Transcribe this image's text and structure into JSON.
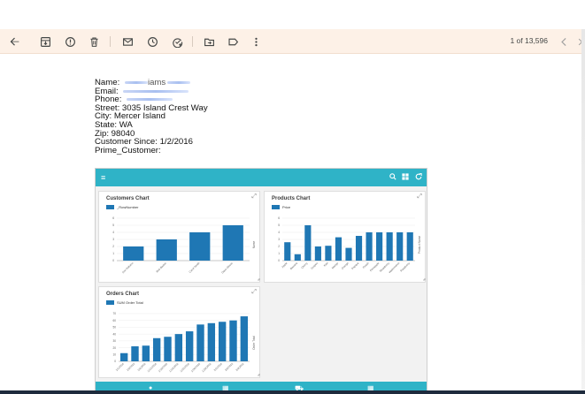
{
  "toolbar": {
    "pager_text": "1 of 13,596"
  },
  "customer": {
    "name_label": "Name:",
    "name_value_visible": "iams",
    "email_label": "Email:",
    "phone_label": "Phone:",
    "street": "Street: 3035 Island Crest Way",
    "city": "City: Mercer Island",
    "state": "State: WA",
    "zip": "Zip: 98040",
    "since": "Customer Since: 1/2/2016",
    "prime": "Prime_Customer:"
  },
  "dashboard": {
    "accent": "#2fb3c7",
    "bar_color": "#1f77b4"
  },
  "chart_data": [
    {
      "type": "bar",
      "title": "Customers Chart",
      "legend": "_RowNumber",
      "categories": [
        "Ann Nakano",
        "Bob Barker",
        "Carol Smith",
        "Dave Glover"
      ],
      "values": [
        2,
        3,
        4,
        5
      ],
      "ylim": [
        0,
        6
      ],
      "yticks": [
        "0",
        "1",
        "2",
        "3",
        "4",
        "5",
        "6"
      ],
      "ylabel": "Name"
    },
    {
      "type": "bar",
      "title": "Products Chart",
      "legend": "Price",
      "categories": [
        "Apple",
        "Banana",
        "Cherry",
        "Grapes",
        "Kiwi",
        "Mango",
        "Orange",
        "Papaya",
        "Peach",
        "Pineapple",
        "Strawberry",
        "Watermelon",
        "Raspberry"
      ],
      "values": [
        2.6,
        0.9,
        5,
        2,
        2.1,
        3.3,
        1.8,
        3.5,
        4,
        4,
        4,
        4,
        4
      ],
      "ylim": [
        0,
        6
      ],
      "yticks": [
        "0",
        "1",
        "2",
        "3",
        "4",
        "5",
        "6"
      ],
      "ylabel": "Product Name"
    },
    {
      "type": "bar",
      "title": "Orders Chart",
      "legend": "SUM Order Total",
      "categories": [
        "1/1/2016",
        "1/5/2016",
        "1/8/2016",
        "1/12/2016",
        "1/15/2016",
        "1/19/2016",
        "1/22/2016",
        "1/26/2016",
        "1/29/2016",
        "2/2/2016",
        "2/5/2016",
        "2/9/2016"
      ],
      "values": [
        12,
        22,
        23,
        34,
        36,
        40,
        44,
        54,
        56,
        58,
        60,
        66
      ],
      "ylim": [
        0,
        70
      ],
      "yticks": [
        "0",
        "10",
        "20",
        "30",
        "40",
        "50",
        "60",
        "70"
      ],
      "ylabel": "Order Total"
    }
  ]
}
